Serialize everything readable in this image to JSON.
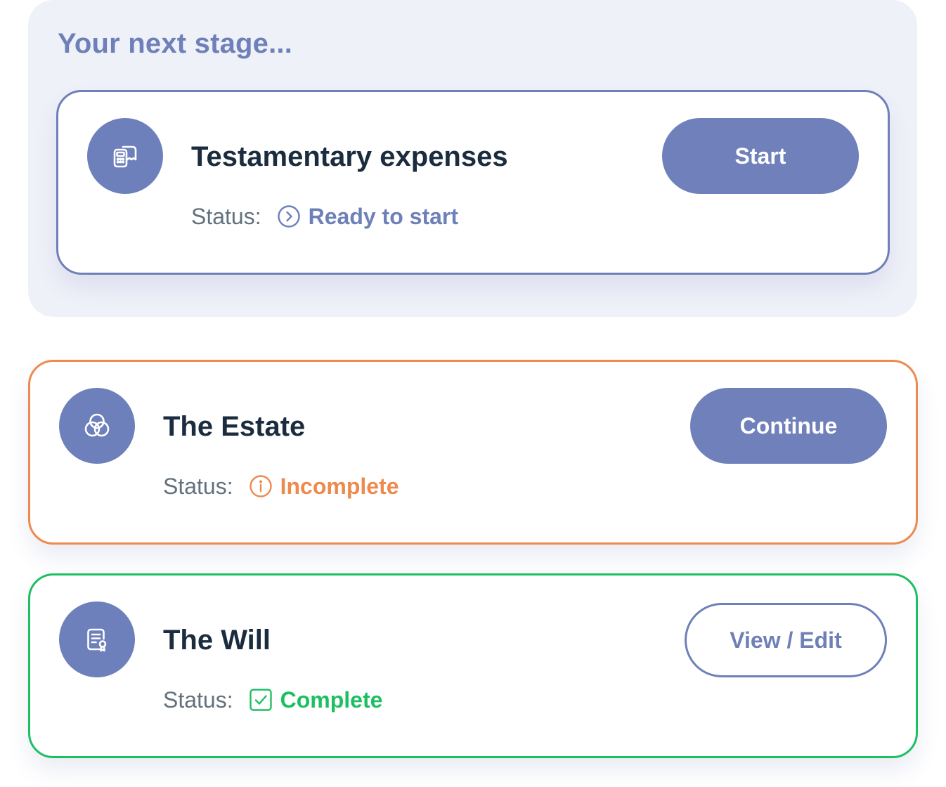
{
  "next_stage": {
    "heading": "Your next stage..."
  },
  "stages": [
    {
      "title": "Testamentary expenses",
      "icon": "calculator-receipt-icon",
      "status_label": "Status:",
      "status_icon": "chevron-right-circle-icon",
      "status_text": "Ready to start",
      "button_label": "Start",
      "button_style": "filled"
    },
    {
      "title": "The Estate",
      "icon": "venn-circles-icon",
      "status_label": "Status:",
      "status_icon": "info-circle-icon",
      "status_text": "Incomplete",
      "button_label": "Continue",
      "button_style": "filled"
    },
    {
      "title": "The Will",
      "icon": "certificate-document-icon",
      "status_label": "Status:",
      "status_icon": "checkbox-checked-icon",
      "status_text": "Complete",
      "button_label": "View / Edit",
      "button_style": "outline"
    }
  ],
  "colors": {
    "primary": "#6f80b9",
    "incomplete": "#ee8a4d",
    "complete": "#1ebf63",
    "title": "#1b2c3f",
    "panel_background": "#eff1f9"
  }
}
